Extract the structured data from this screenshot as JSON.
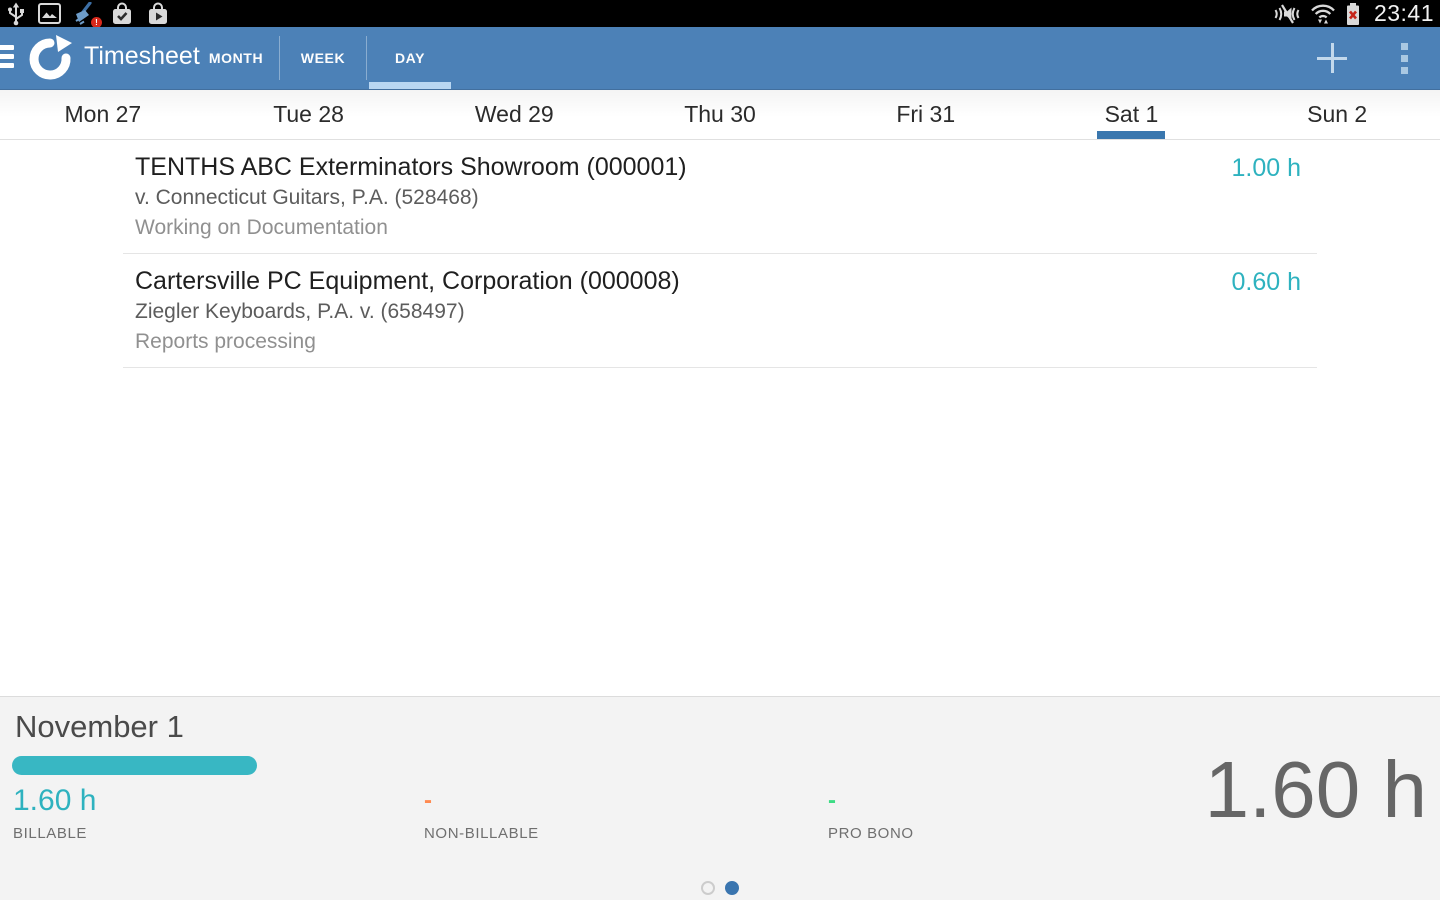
{
  "status_bar": {
    "time": "23:41",
    "left_icons": [
      "usb-icon",
      "screenshot-icon",
      "clean-notification-icon",
      "task-check-icon",
      "play-store-icon"
    ],
    "right_icons": [
      "vibrate-muted-icon",
      "wifi-icon",
      "battery-unknown-icon"
    ]
  },
  "app_bar": {
    "title": "Timesheet",
    "tabs": [
      {
        "label": "MONTH"
      },
      {
        "label": "WEEK"
      },
      {
        "label": "DAY"
      }
    ],
    "active_tab": "DAY",
    "actions": {
      "add": "add-entry",
      "overflow": "more-options"
    }
  },
  "day_strip": {
    "days": [
      {
        "label": "Mon 27"
      },
      {
        "label": "Tue 28"
      },
      {
        "label": "Wed 29"
      },
      {
        "label": "Thu 30"
      },
      {
        "label": "Fri 31"
      },
      {
        "label": "Sat 1"
      },
      {
        "label": "Sun 2"
      }
    ],
    "active_day": "Sat 1"
  },
  "entries": [
    {
      "title": "TENTHS ABC Exterminators Showroom (000001)",
      "subtitle": "v. Connecticut Guitars, P.A. (528468)",
      "description": "Working on Documentation",
      "hours": "1.00 h"
    },
    {
      "title": "Cartersville PC Equipment, Corporation (000008)",
      "subtitle": "Ziegler Keyboards, P.A. v. (658497)",
      "description": "Reports processing",
      "hours": "0.60 h"
    }
  ],
  "summary": {
    "date": "November 1",
    "progress_percent": 17,
    "stats": [
      {
        "value": "1.60 h",
        "label": "BILLABLE",
        "color": "#2eb2bf"
      },
      {
        "value": "-",
        "label": "NON-BILLABLE",
        "color": "#ff8a50"
      },
      {
        "value": "-",
        "label": "PRO BONO",
        "color": "#3ddc84"
      }
    ],
    "total": "1.60 h"
  },
  "pager": {
    "total_pages": 2,
    "active_page": 2
  },
  "colors": {
    "app_bar_blue": "#4c81b7",
    "tab_indicator": "#b9d7f2",
    "day_indicator": "#3a77ae",
    "accent_teal": "#2eb2bf",
    "non_billable_orange": "#ff8a50",
    "pro_bono_green": "#3ddc84",
    "total_gray": "#666666"
  }
}
